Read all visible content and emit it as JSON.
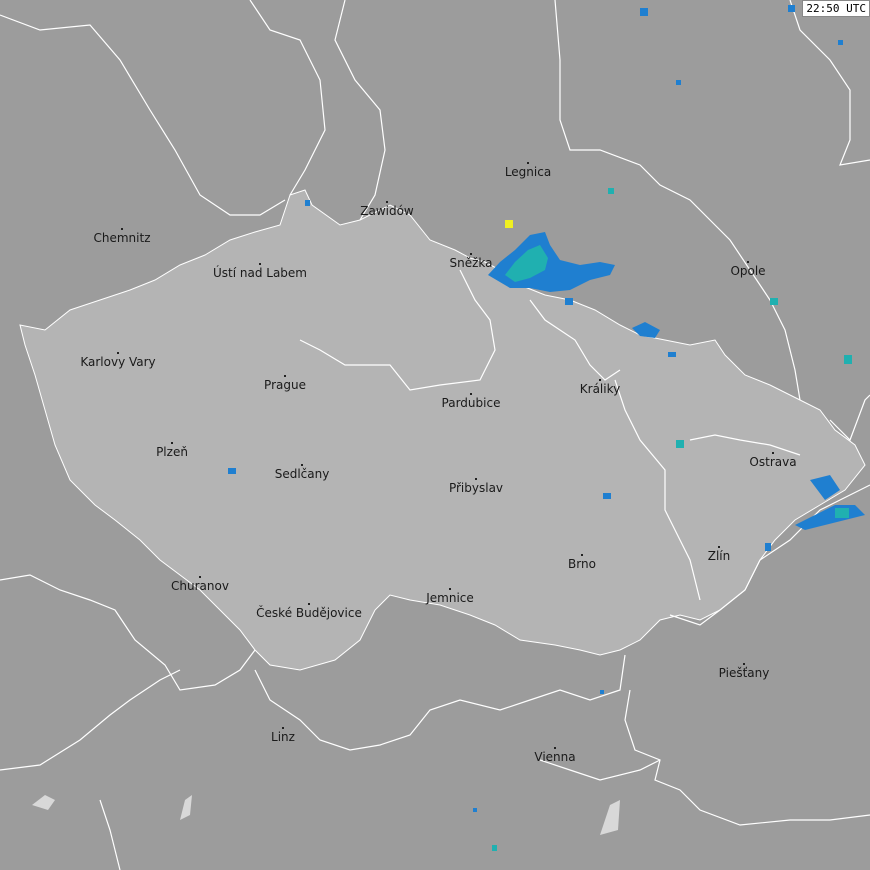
{
  "timestamp": "22:50 UTC",
  "colors": {
    "background": "#9c9c9c",
    "country": "#b4b4b4",
    "border": "#ffffff",
    "precip_cyan": "#20b0b0",
    "precip_blue": "#1f7fd0",
    "precip_yellow": "#f0f020",
    "lake": "#d8d8d8"
  },
  "cities": [
    {
      "id": "chemnitz",
      "name": "Chemnitz"
    },
    {
      "id": "usti",
      "name": "Ústí nad Labem"
    },
    {
      "id": "zawidow",
      "name": "Zawidów"
    },
    {
      "id": "legnica",
      "name": "Legnica"
    },
    {
      "id": "snezka",
      "name": "Sněžka"
    },
    {
      "id": "opole",
      "name": "Opole"
    },
    {
      "id": "karlovy",
      "name": "Karlovy Vary"
    },
    {
      "id": "prague",
      "name": "Prague"
    },
    {
      "id": "pardubice",
      "name": "Pardubice"
    },
    {
      "id": "kraliky",
      "name": "Králiky"
    },
    {
      "id": "plzen",
      "name": "Plzeň"
    },
    {
      "id": "sedlcany",
      "name": "Sedlčany"
    },
    {
      "id": "pribyslav",
      "name": "Přibyslav"
    },
    {
      "id": "ostrava",
      "name": "Ostrava"
    },
    {
      "id": "zlin",
      "name": "Zlín"
    },
    {
      "id": "brno",
      "name": "Brno"
    },
    {
      "id": "churanov",
      "name": "Churanov"
    },
    {
      "id": "budejovice",
      "name": "České Budějovice"
    },
    {
      "id": "jemnice",
      "name": "Jemnice"
    },
    {
      "id": "piestany",
      "name": "Piešťany"
    },
    {
      "id": "linz",
      "name": "Linz"
    },
    {
      "id": "vienna",
      "name": "Vienna"
    }
  ]
}
